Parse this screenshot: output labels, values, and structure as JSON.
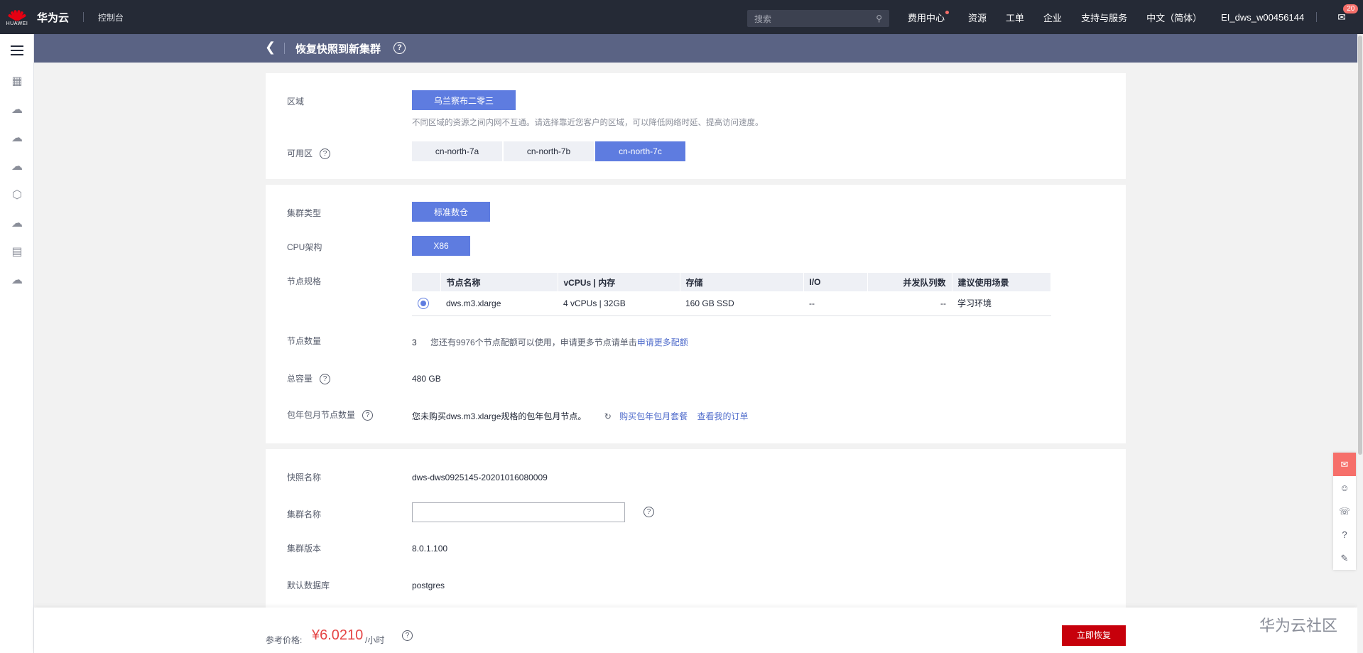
{
  "topbar": {
    "logo_word": "HUAWEI",
    "brand": "华为云",
    "console": "控制台",
    "search_placeholder": "搜索",
    "nav": [
      "费用中心",
      "资源",
      "工单",
      "企业",
      "支持与服务",
      "中文（简体）",
      "EI_dws_w00456144"
    ],
    "mail_badge": "20"
  },
  "subheader": {
    "title": "恢复快照到新集群",
    "help": "?"
  },
  "region_card": {
    "region_label": "区域",
    "region_value": "乌兰察布二零三",
    "region_desc": "不同区域的资源之间内网不互通。请选择靠近您客户的区域，可以降低网络时延、提高访问速度。",
    "az_label": "可用区",
    "az_tabs": [
      "cn-north-7a",
      "cn-north-7b",
      "cn-north-7c"
    ],
    "az_selected": "cn-north-7c"
  },
  "spec_card": {
    "cluster_type_label": "集群类型",
    "cluster_type_value": "标准数仓",
    "cpu_label": "CPU架构",
    "cpu_value": "X86",
    "node_spec_label": "节点规格",
    "table_headers": [
      "节点名称",
      "vCPUs | 内存",
      "存储",
      "I/O",
      "并发队列数",
      "建议使用场景"
    ],
    "table_rows": [
      [
        "dws.m3.xlarge",
        "4 vCPUs | 32GB",
        "160 GB SSD",
        "--",
        "--",
        "学习环境"
      ]
    ],
    "node_count_label": "节点数量",
    "node_count_value": "3",
    "node_quota_text": "您还有9976个节点配额可以使用，申请更多节点请单击",
    "node_quota_link": "申请更多配额",
    "capacity_label": "总容量",
    "capacity_value": "480 GB",
    "monthly_label": "包年包月节点数量",
    "monthly_text": "您未购买dws.m3.xlarge规格的包年包月节点。",
    "buy_link": "购买包年包月套餐",
    "orders_link": "查看我的订单"
  },
  "snapshot_card": {
    "snapshot_name_label": "快照名称",
    "snapshot_name_value": "dws-dws0925145-20201016080009",
    "cluster_name_label": "集群名称",
    "cluster_name_value": "",
    "version_label": "集群版本",
    "version_value": "8.0.1.100",
    "db_label": "默认数据库",
    "db_value": "postgres"
  },
  "footer": {
    "price_label": "参考价格:",
    "price": "¥6.0210",
    "unit": "/小时",
    "restore_button": "立即恢复"
  },
  "watermark": "华为云社区",
  "colors": {
    "topbar": "#252a36",
    "subheader": "#5a6384",
    "accent": "#5e7ce0",
    "danger": "#c7000b",
    "price": "#e54545"
  }
}
